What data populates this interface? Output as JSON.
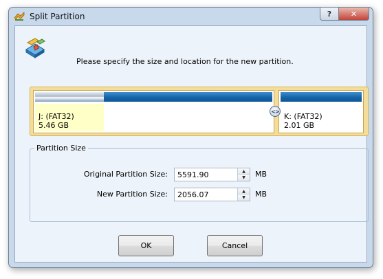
{
  "window": {
    "title": "Split Partition",
    "help_label": "?",
    "close_label": "✕"
  },
  "instruction": "Please specify the size and location for the new partition.",
  "partitions": [
    {
      "drive": "J: (FAT32)",
      "size": "5.46 GB",
      "used_fraction": 0.29
    },
    {
      "drive": "K: (FAT32)",
      "size": "2.01 GB",
      "used_fraction": 0.0
    }
  ],
  "divider_glyph": "<>",
  "partition_size": {
    "group_title": "Partition Size",
    "original_label": "Original Partition Size:",
    "original_value": "5591.90",
    "original_unit": "MB",
    "new_label": "New Partition Size:",
    "new_value": "2056.07",
    "new_unit": "MB"
  },
  "buttons": {
    "ok": "OK",
    "cancel": "Cancel"
  },
  "icons": {
    "title": "partition-app-icon",
    "header": "disk-split-icon",
    "spin_up": "▲",
    "spin_down": "▼"
  },
  "colors": {
    "window_frame": "#c8d9ec",
    "client_bg": "#edf3fa",
    "partition_bar": "#1565a8",
    "partition_map_border": "#f4dd9a",
    "used_space": "#ffffc8"
  }
}
